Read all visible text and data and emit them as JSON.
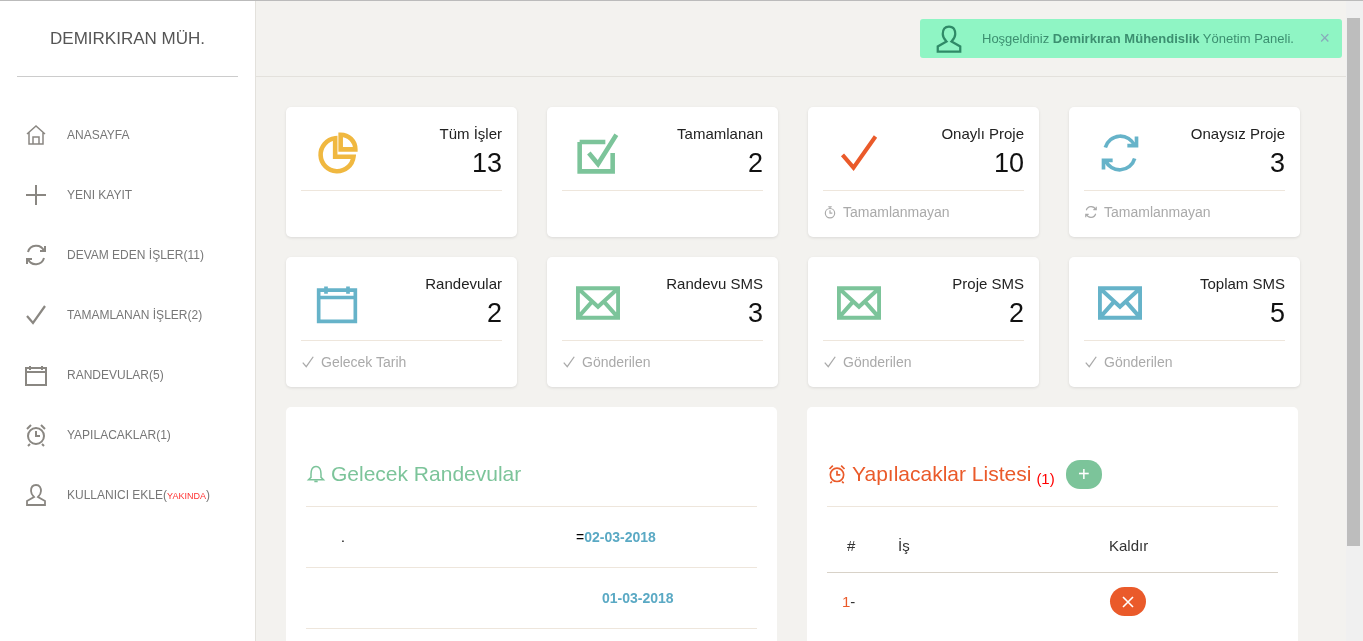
{
  "sidebar": {
    "brand": "DEMIRKIRAN MÜH.",
    "items": [
      {
        "kind": "home",
        "label": "ANASAYFA"
      },
      {
        "kind": "plus",
        "label": "YENI KAYIT"
      },
      {
        "kind": "refresh",
        "label": "DEVAM EDEN İŞLER(11)"
      },
      {
        "kind": "check",
        "label": "TAMAMLANAN İŞLER(2)"
      },
      {
        "kind": "calendar",
        "label": "RANDEVULAR(5)"
      },
      {
        "kind": "alarm",
        "label": "YAPILACAKLAR(1)"
      },
      {
        "kind": "user",
        "label": "KULLANICI EKLE(",
        "tag": "YAKINDA",
        "tail": ")"
      }
    ]
  },
  "alert": {
    "text": "Hoşgeldiniz **Demirkıran Mühendislik** Yönetim Paneli.",
    "close": "×"
  },
  "stats": [
    {
      "title": "Tüm İşler",
      "value": "13",
      "kind": "pie",
      "color": "#f0b840"
    },
    {
      "title": "Tamamlanan",
      "value": "2",
      "kind": "checkbox",
      "color": "#7cc49a"
    },
    {
      "title": "Onaylı Proje",
      "value": "10",
      "kind": "check",
      "color": "#ea5a2a",
      "footer": {
        "kind": "stopwatch",
        "text": "Tamamlanmayan"
      }
    },
    {
      "title": "Onaysız Proje",
      "value": "3",
      "kind": "refresh",
      "color": "#66b3c9",
      "footer": {
        "kind": "refresh",
        "text": "Tamamlanmayan"
      }
    },
    {
      "title": "Randevular",
      "value": "2",
      "kind": "calendar",
      "color": "#66b3c9",
      "footer": {
        "kind": "check",
        "text": "Gelecek Tarih"
      }
    },
    {
      "title": "Randevu SMS",
      "value": "3",
      "kind": "mail",
      "color": "#7cc49a",
      "footer": {
        "kind": "check",
        "text": "Gönderilen"
      }
    },
    {
      "title": "Proje SMS",
      "value": "2",
      "kind": "mail",
      "color": "#7cc49a",
      "footer": {
        "kind": "check",
        "text": "Gönderilen"
      }
    },
    {
      "title": "Toplam SMS",
      "value": "5",
      "kind": "mail",
      "color": "#66b3c9",
      "footer": {
        "kind": "check",
        "text": "Gönderilen"
      }
    }
  ],
  "appointments": {
    "title": "Gelecek Randevular",
    "rows": [
      {
        "name": ".",
        "prefix": "=",
        "date": "02-03-2018"
      },
      {
        "date": "01-03-2018"
      }
    ]
  },
  "todo": {
    "title": "Yapılacaklar Listesi",
    "count": "(1)",
    "add": "+",
    "columns": [
      "#",
      "İş",
      "Kaldır"
    ],
    "rows": [
      {
        "number": "1",
        "suffix": "-"
      }
    ]
  }
}
